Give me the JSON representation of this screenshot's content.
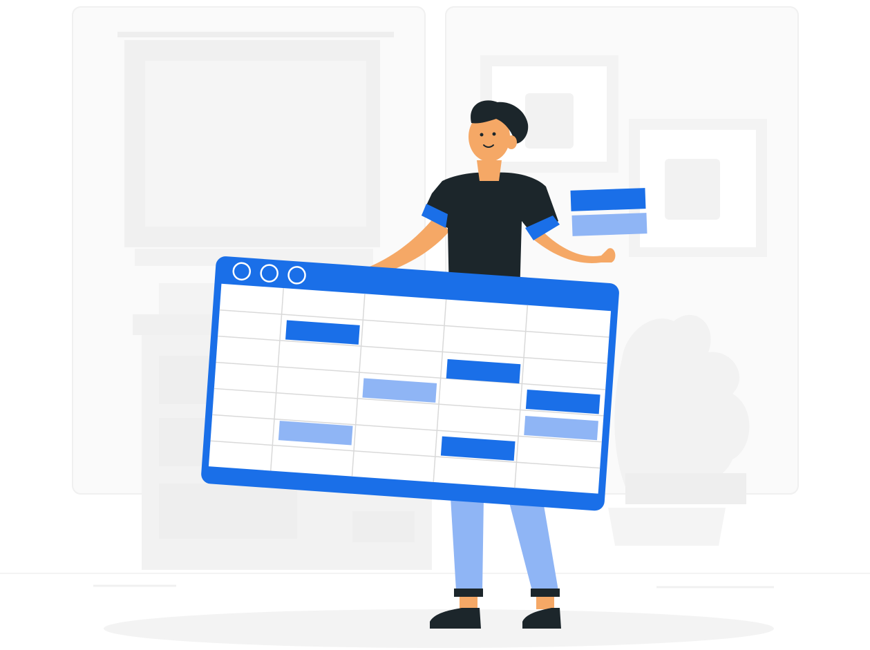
{
  "illustration": {
    "colors": {
      "accent_blue": "#1a6fe8",
      "light_blue": "#8fb5f5",
      "shirt": "#1c262b",
      "skin": "#f5a866",
      "hair": "#1c262b",
      "pants": "#8fb5f5",
      "shoes": "#1c262b",
      "background_gray": "#f2f2f2"
    },
    "window": {
      "icons": [
        "circle-icon",
        "circle-icon",
        "circle-icon"
      ],
      "grid_rows": 7,
      "grid_cols": 5
    }
  }
}
